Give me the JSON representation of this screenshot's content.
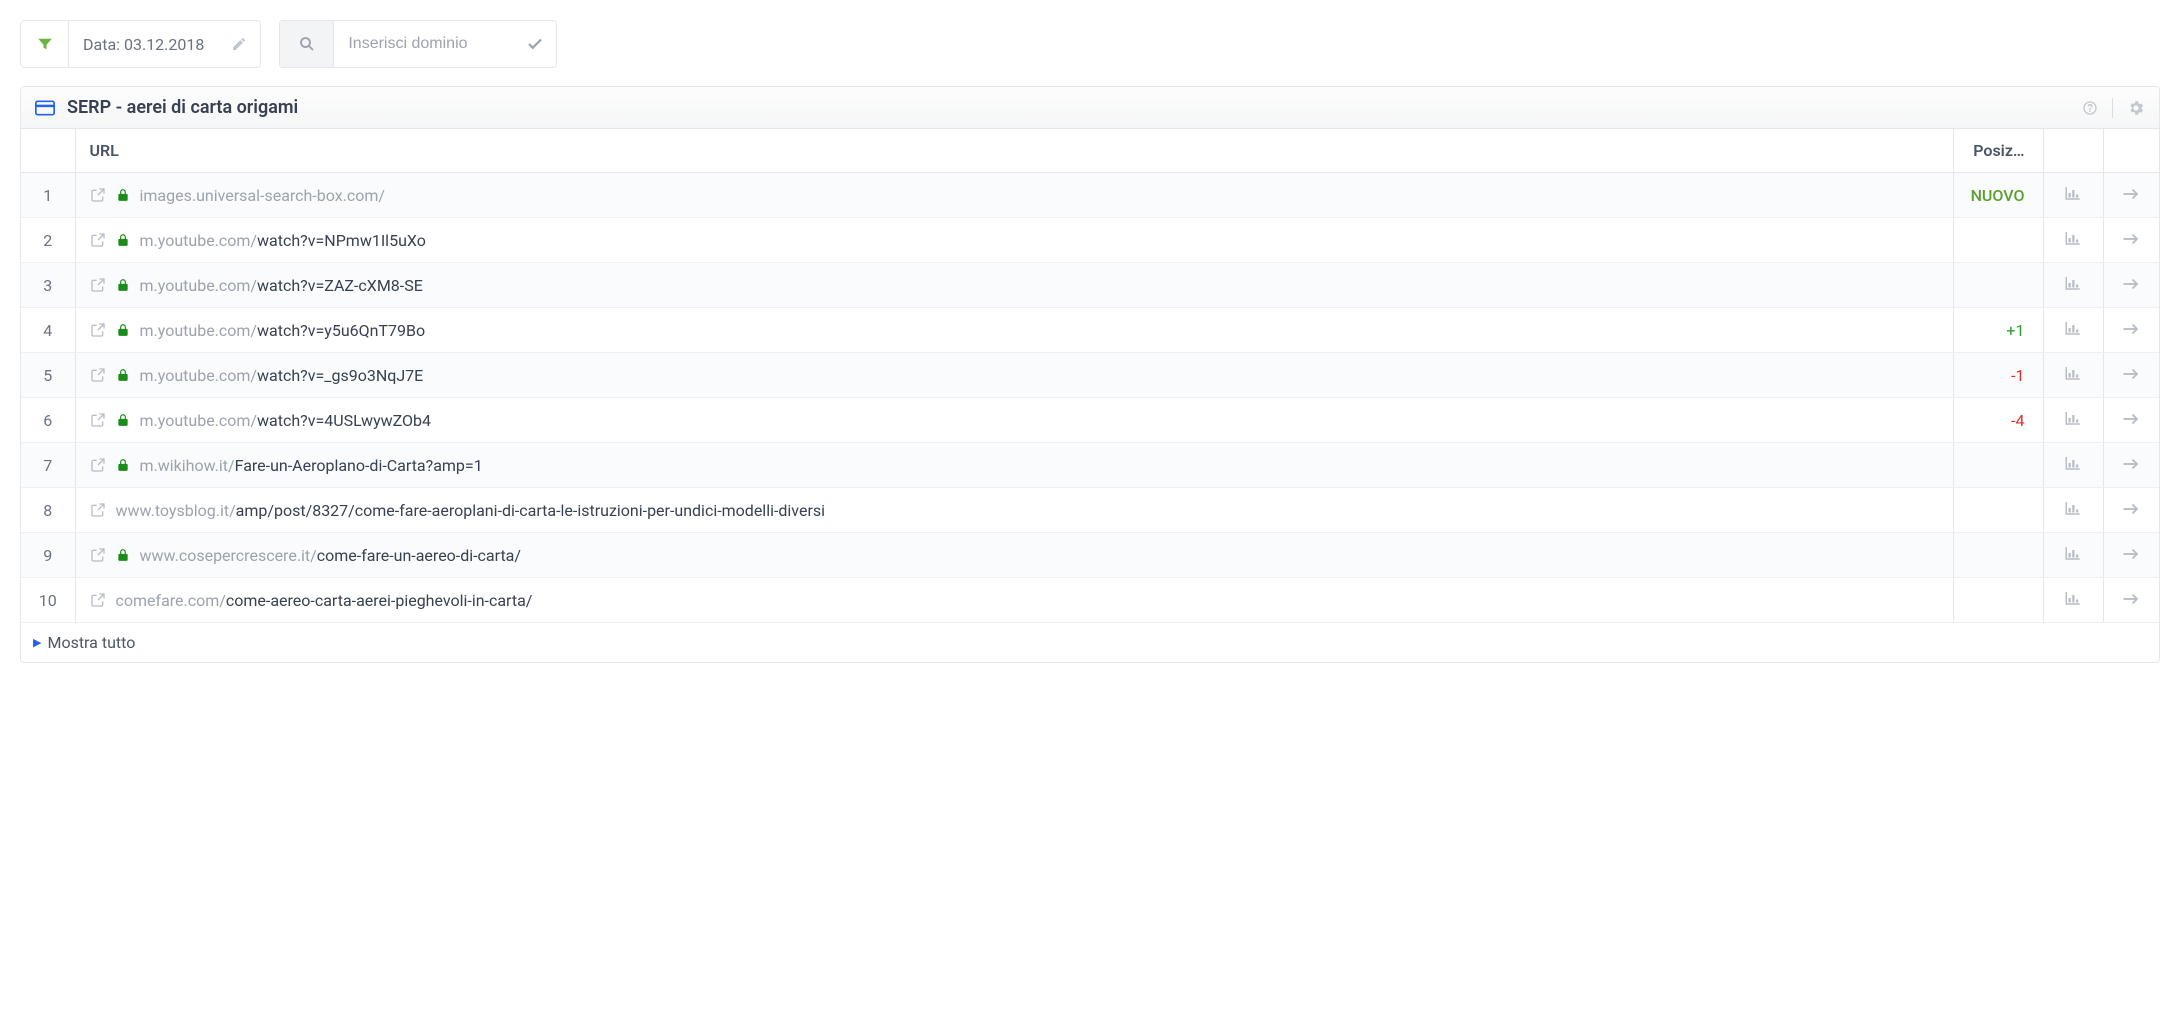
{
  "toolbar": {
    "date_label": "Data: 03.12.2018",
    "domain_placeholder": "Inserisci dominio"
  },
  "panel": {
    "title": "SERP - aerei di carta origami"
  },
  "columns": {
    "url": "URL",
    "position": "Posiz…"
  },
  "rows": [
    {
      "num": "1",
      "https": true,
      "domain": "images.universal-search-box.com/",
      "path": "",
      "pos_text": "NUOVO",
      "pos_class": "pos-nuovo"
    },
    {
      "num": "2",
      "https": true,
      "domain": "m.youtube.com/",
      "path": "watch?v=NPmw1Il5uXo",
      "pos_text": "",
      "pos_class": ""
    },
    {
      "num": "3",
      "https": true,
      "domain": "m.youtube.com/",
      "path": "watch?v=ZAZ-cXM8-SE",
      "pos_text": "",
      "pos_class": ""
    },
    {
      "num": "4",
      "https": true,
      "domain": "m.youtube.com/",
      "path": "watch?v=y5u6QnT79Bo",
      "pos_text": "+1",
      "pos_class": "pos-up"
    },
    {
      "num": "5",
      "https": true,
      "domain": "m.youtube.com/",
      "path": "watch?v=_gs9o3NqJ7E",
      "pos_text": "-1",
      "pos_class": "pos-down"
    },
    {
      "num": "6",
      "https": true,
      "domain": "m.youtube.com/",
      "path": "watch?v=4USLwywZOb4",
      "pos_text": "-4",
      "pos_class": "pos-down"
    },
    {
      "num": "7",
      "https": true,
      "domain": "m.wikihow.it/",
      "path": "Fare-un-Aeroplano-di-Carta?amp=1",
      "pos_text": "",
      "pos_class": ""
    },
    {
      "num": "8",
      "https": false,
      "domain": "www.toysblog.it/",
      "path": "amp/post/8327/come-fare-aeroplani-di-carta-le-istruzioni-per-undici-modelli-diversi",
      "pos_text": "",
      "pos_class": ""
    },
    {
      "num": "9",
      "https": true,
      "domain": "www.cosepercrescere.it/",
      "path": "come-fare-un-aereo-di-carta/",
      "pos_text": "",
      "pos_class": ""
    },
    {
      "num": "10",
      "https": false,
      "domain": "comefare.com/",
      "path": "come-aereo-carta-aerei-pieghevoli-in-carta/",
      "pos_text": "",
      "pos_class": ""
    }
  ],
  "footer": {
    "show_all": "Mostra tutto"
  }
}
